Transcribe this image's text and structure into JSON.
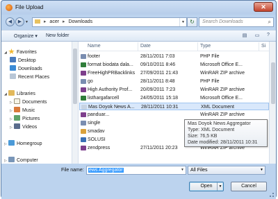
{
  "window": {
    "title": "File Upload",
    "close_symbol": "✕"
  },
  "navbar": {
    "back_symbol": "◀",
    "forward_symbol": "▶",
    "breadcrumb": [
      "acer",
      "Downloads"
    ],
    "refresh_symbol": "↻",
    "search_placeholder": "Search Downloads"
  },
  "toolbar": {
    "organize_label": "Organize ▾",
    "new_folder_label": "New folder"
  },
  "nav_pane": {
    "favorites": {
      "label": "Favorites",
      "items": [
        "Desktop",
        "Downloads",
        "Recent Places"
      ]
    },
    "libraries": {
      "label": "Libraries",
      "items": [
        "Documents",
        "Music",
        "Pictures",
        "Videos"
      ]
    },
    "homegroup": "Homegroup",
    "computer": "Computer"
  },
  "file_list": {
    "columns": {
      "name": "Name",
      "date": "Date",
      "type": "Type",
      "size": "Si"
    },
    "rows": [
      {
        "name": "footer",
        "date": "28/11/2011 7:03",
        "type": "PHP File",
        "icon_color": "#7a8db0"
      },
      {
        "name": "format biodata dala...",
        "date": "09/10/2011 8:46",
        "type": "Microsoft Office E...",
        "icon_color": "#2f7d3a"
      },
      {
        "name": "FreeHighPRBacklinks",
        "date": "27/09/2011 21:43",
        "type": "WinRAR ZIP archive",
        "icon_color": "#7d3f8c"
      },
      {
        "name": "go",
        "date": "28/11/2011 8:48",
        "type": "PHP File",
        "icon_color": "#7a8db0"
      },
      {
        "name": "High Authority Prof...",
        "date": "20/09/2011 7:23",
        "type": "WinRAR ZIP archive",
        "icon_color": "#7d3f8c"
      },
      {
        "name": "listhargafarcell",
        "date": "24/05/2011 15:18",
        "type": "Microsoft Office E...",
        "icon_color": "#2f7d3a"
      },
      {
        "name": "Mas Doyok News A...",
        "date": "28/11/2011 10:31",
        "type": "XML Document",
        "icon_color": "#c7d3e3"
      },
      {
        "name": "panduar...",
        "date": "",
        "type": "WinRAR ZIP archive",
        "icon_color": "#7d3f8c"
      },
      {
        "name": "single",
        "date": "",
        "type": "PHP File",
        "icon_color": "#7a8db0"
      },
      {
        "name": "smadav",
        "date": "",
        "type": "Application",
        "icon_color": "#d9a13b"
      },
      {
        "name": "SOLUSI",
        "date": "",
        "type": "ACDSee 9.0 GIF Im...",
        "icon_color": "#3a6fb5"
      },
      {
        "name": "zendpress",
        "date": "27/11/2011 20:23",
        "type": "WinRAR ZIP archive",
        "icon_color": "#7d3f8c"
      }
    ]
  },
  "tooltip": {
    "line1": "Mas Doyok News Aggregator",
    "line2": "Type: XML Document",
    "line3": "Size: 76,5 KB",
    "line4": "Date modified: 28/11/2011 10:31"
  },
  "bottom": {
    "filename_label": "File name:",
    "filename_value": "ews Aggregator",
    "filter_value": "All Files",
    "open_label": "Open",
    "cancel_label": "Cancel"
  }
}
